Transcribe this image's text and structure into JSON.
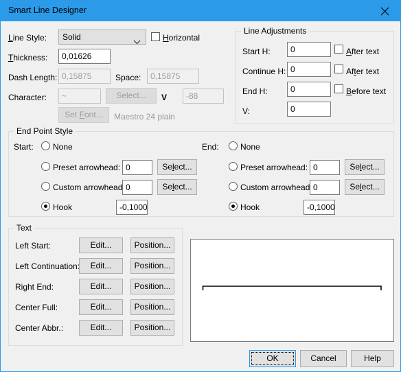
{
  "window": {
    "title": "Smart Line Designer",
    "close_icon": "close-icon",
    "titlebar_color": "#2b9ae8"
  },
  "line_props": {
    "line_style_label": "Line Style:",
    "line_style_value": "Solid",
    "line_style_options": [
      "Solid"
    ],
    "horizontal_label": "Horizontal",
    "horizontal_checked": false,
    "thickness_label": "Thickness:",
    "thickness_value": "0,01626",
    "dash_length_label": "Dash Length:",
    "dash_length_value": "0,15875",
    "space_label": "Space:",
    "space_value": "0,15875",
    "character_label": "Character:",
    "character_value": "~",
    "character_select_label": "Select...",
    "v_label": "V",
    "v_value": "-88",
    "set_font_label": "Set Font...",
    "font_name": "Maestro 24 plain"
  },
  "line_adjustments": {
    "title": "Line Adjustments",
    "rows": [
      {
        "label": "Start H:",
        "value": "0",
        "check_label": "After text",
        "checked": false
      },
      {
        "label": "Continue H:",
        "value": "0",
        "check_label": "After text",
        "checked": false
      },
      {
        "label": "End H:",
        "value": "0",
        "check_label": "Before text",
        "checked": false
      }
    ],
    "v_label": "V:",
    "v_value": "0"
  },
  "end_point_style": {
    "title": "End Point Style",
    "start": {
      "side_label": "Start:",
      "none_label": "None",
      "none_selected": false,
      "preset_label": "Preset arrowhead:",
      "preset_selected": false,
      "preset_value": "0",
      "preset_select_label": "Select...",
      "custom_label": "Custom arrowhead:",
      "custom_selected": false,
      "custom_value": "0",
      "custom_select_label": "Select...",
      "hook_label": "Hook",
      "hook_selected": true,
      "hook_value": "-0,1000"
    },
    "end": {
      "side_label": "End:",
      "none_label": "None",
      "none_selected": false,
      "preset_label": "Preset arrowhead:",
      "preset_selected": false,
      "preset_value": "0",
      "preset_select_label": "Select...",
      "custom_label": "Custom arrowhead:",
      "custom_selected": false,
      "custom_value": "0",
      "custom_select_label": "Select...",
      "hook_label": "Hook",
      "hook_selected": true,
      "hook_value": "-0,1000"
    }
  },
  "text_group": {
    "title": "Text",
    "rows": [
      {
        "label": "Left Start:",
        "edit_label": "Edit...",
        "position_label": "Position..."
      },
      {
        "label": "Left Continuation:",
        "edit_label": "Edit...",
        "position_label": "Position..."
      },
      {
        "label": "Right End:",
        "edit_label": "Edit...",
        "position_label": "Position..."
      },
      {
        "label": "Center Full:",
        "edit_label": "Edit...",
        "position_label": "Position..."
      },
      {
        "label": "Center Abbr.:",
        "edit_label": "Edit...",
        "position_label": "Position..."
      }
    ]
  },
  "preview": {
    "name": "line-preview"
  },
  "footer": {
    "ok_label": "OK",
    "cancel_label": "Cancel",
    "help_label": "Help"
  }
}
